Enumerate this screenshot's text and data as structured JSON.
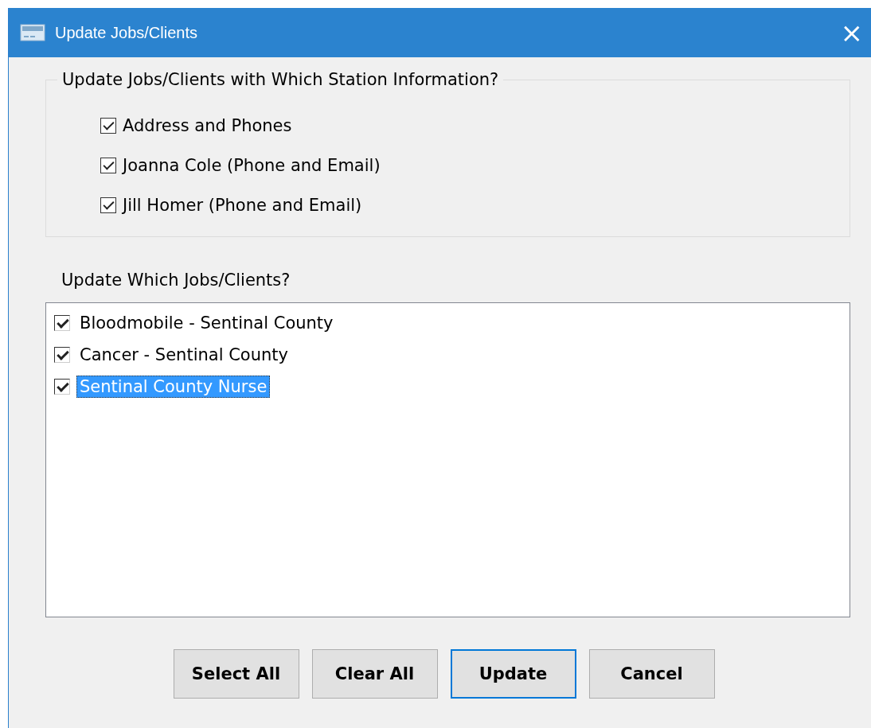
{
  "window": {
    "title": "Update Jobs/Clients",
    "close": "×"
  },
  "station_group": {
    "label": "Update Jobs/Clients with Which Station Information?",
    "options": [
      {
        "label": "Address and Phones",
        "checked": true
      },
      {
        "label": "Joanna Cole (Phone and Email)",
        "checked": true
      },
      {
        "label": "Jill Homer (Phone and Email)",
        "checked": true
      }
    ]
  },
  "jobs_label": "Update Which Jobs/Clients?",
  "jobs_list": [
    {
      "label": "Bloodmobile - Sentinal County",
      "checked": true,
      "selected": false
    },
    {
      "label": "Cancer - Sentinal County",
      "checked": true,
      "selected": false
    },
    {
      "label": "Sentinal County Nurse",
      "checked": true,
      "selected": true
    }
  ],
  "buttons": [
    {
      "label": "Select All",
      "default": false
    },
    {
      "label": "Clear All",
      "default": false
    },
    {
      "label": "Update",
      "default": true
    },
    {
      "label": "Cancel",
      "default": false
    }
  ]
}
